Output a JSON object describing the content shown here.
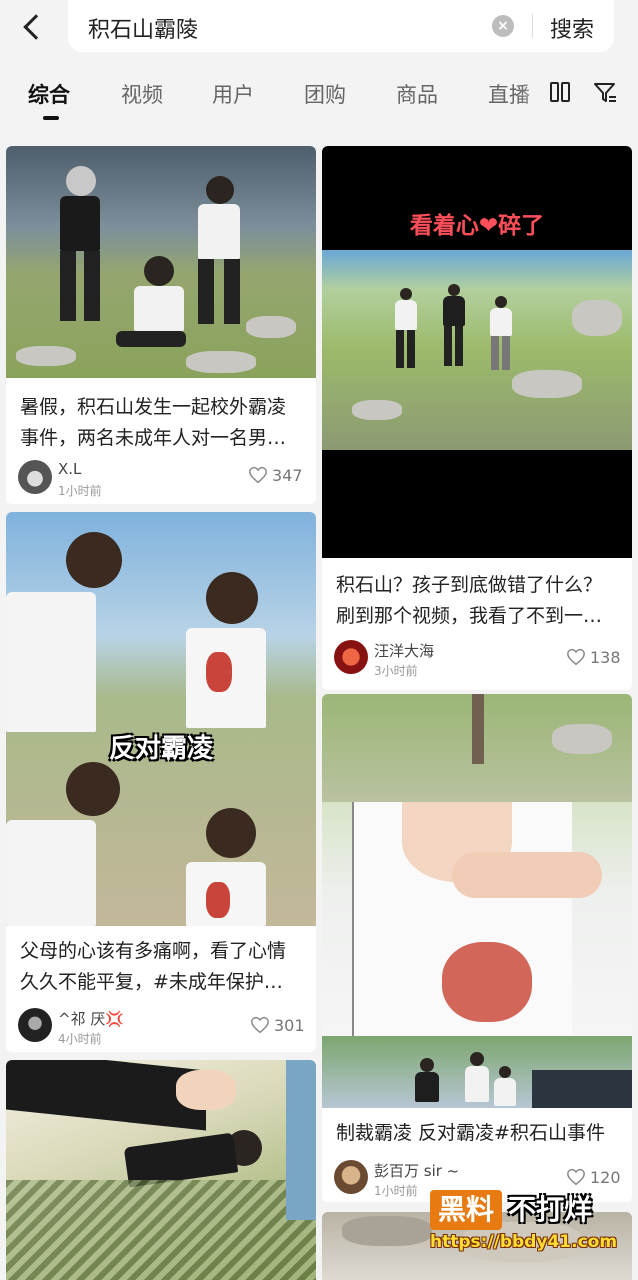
{
  "search": {
    "query": "积石山霸陵",
    "button_label": "搜索"
  },
  "tabs": [
    {
      "label": "综合"
    },
    {
      "label": "视频"
    },
    {
      "label": "用户"
    },
    {
      "label": "团购"
    },
    {
      "label": "商品"
    },
    {
      "label": "直播"
    }
  ],
  "cards": [
    {
      "title": "暑假，积石山发生一起校外霸凌事件，两名未成年人对一名男…",
      "author": "X.L",
      "time": "1小时前",
      "likes": "347"
    },
    {
      "overlay": "看着心❤碎了",
      "title": "积石山？孩子到底做错了什么？刷到那个视频，我看了不到一…",
      "author": "汪洋大海",
      "time": "3小时前",
      "likes": "138"
    },
    {
      "overlay": "反对霸凌",
      "title": "父母的心该有多痛啊，看了心情久久不能平复，#未成年保护…",
      "author": "^祁 厌💢",
      "time": "4小时前",
      "likes": "301"
    },
    {
      "title": "制裁霸凌 反对霸凌#积石山事件",
      "author": "彭百万 sir ~",
      "time": "1小时前",
      "likes": "120"
    }
  ],
  "watermark": {
    "left": "黑料",
    "right": "不打烊",
    "url": "https://bbdy41.com"
  }
}
